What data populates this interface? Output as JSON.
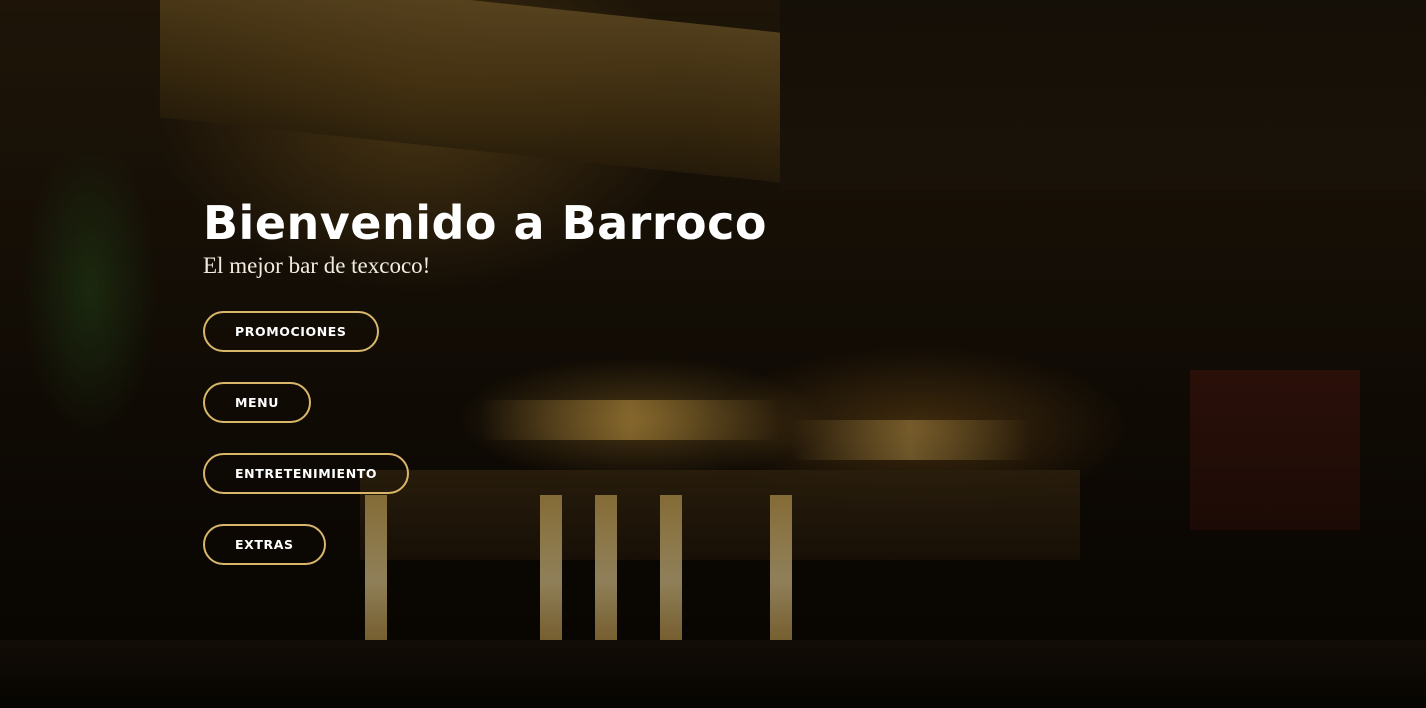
{
  "hero": {
    "title": "Bienvenido a Barroco",
    "subtitle": "El mejor bar de texcoco!"
  },
  "nav_buttons": [
    {
      "label": "PROMOCIONES"
    },
    {
      "label": "MENU"
    },
    {
      "label": "ENTRETENIMIENTO"
    },
    {
      "label": "EXTRAS"
    }
  ],
  "colors": {
    "button_border": "#d8b66a",
    "text": "#ffffff"
  }
}
